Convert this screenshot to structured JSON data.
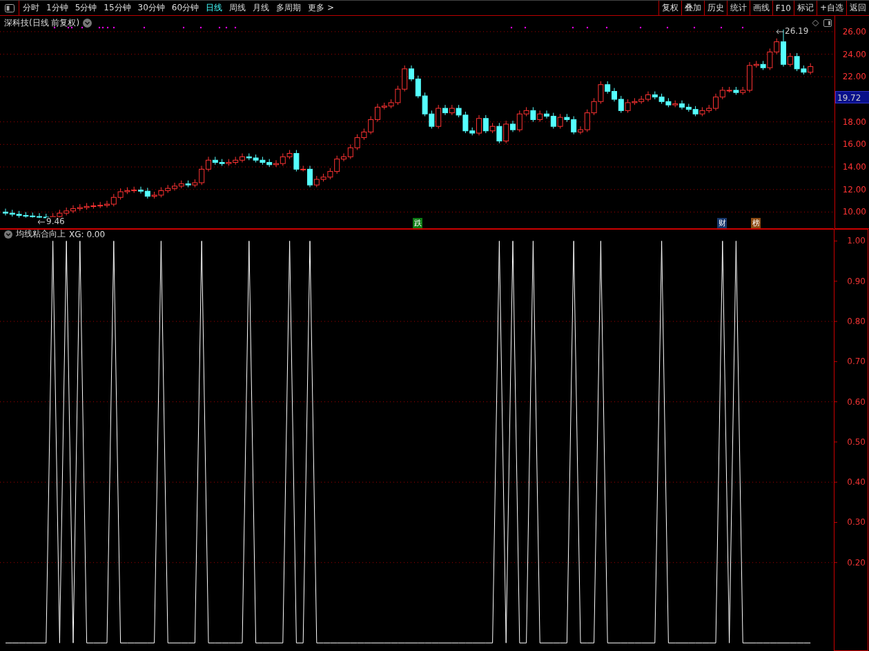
{
  "toolbar": {
    "periods": [
      {
        "label": "分时",
        "selected": false
      },
      {
        "label": "1分钟",
        "selected": false
      },
      {
        "label": "5分钟",
        "selected": false
      },
      {
        "label": "15分钟",
        "selected": false
      },
      {
        "label": "30分钟",
        "selected": false
      },
      {
        "label": "60分钟",
        "selected": false
      },
      {
        "label": "日线",
        "selected": true
      },
      {
        "label": "周线",
        "selected": false
      },
      {
        "label": "月线",
        "selected": false
      },
      {
        "label": "多周期",
        "selected": false
      },
      {
        "label": "更多 >",
        "selected": false
      }
    ],
    "buttons": [
      "复权",
      "叠加",
      "历史",
      "统计",
      "画线",
      "F10",
      "标记",
      "+自选",
      "返回"
    ]
  },
  "price_chart": {
    "title": "深科技(日线 前复权)",
    "current_price": "19.72",
    "high_label": "26.19",
    "low_label": "9.46",
    "markers": [
      {
        "label": "跌",
        "color": "#0b7a12"
      },
      {
        "label": "财",
        "color": "#17376b"
      },
      {
        "label": "榜",
        "color": "#8b4a12"
      }
    ],
    "chart_data": {
      "type": "candlestick",
      "ylim": [
        8.5,
        27.4
      ],
      "grid": true,
      "yticks": [
        {
          "value": 26,
          "label": "26.00"
        },
        {
          "value": 24,
          "label": "24.00"
        },
        {
          "value": 22,
          "label": "22.00"
        },
        {
          "value": 18,
          "label": "18.00"
        },
        {
          "value": 16,
          "label": "16.00"
        },
        {
          "value": 14,
          "label": "14.00"
        },
        {
          "value": 12,
          "label": "12.00"
        },
        {
          "value": 10,
          "label": "10.00"
        }
      ],
      "ohlc": [
        [
          10.0,
          10.3,
          9.7,
          9.9
        ],
        [
          9.9,
          10.2,
          9.6,
          9.8
        ],
        [
          9.8,
          10.1,
          9.5,
          9.7
        ],
        [
          9.7,
          10.0,
          9.5,
          9.65
        ],
        [
          9.65,
          9.95,
          9.5,
          9.6
        ],
        [
          9.6,
          9.9,
          9.46,
          9.55
        ],
        [
          9.55,
          9.85,
          9.5,
          9.5
        ],
        [
          9.5,
          9.9,
          9.5,
          9.6
        ],
        [
          9.6,
          10.2,
          9.4,
          9.9
        ],
        [
          9.9,
          10.4,
          9.7,
          10.1
        ],
        [
          10.1,
          10.6,
          9.9,
          10.3
        ],
        [
          10.3,
          10.7,
          10.1,
          10.4
        ],
        [
          10.4,
          10.8,
          10.2,
          10.5
        ],
        [
          10.5,
          10.85,
          10.3,
          10.55
        ],
        [
          10.55,
          10.9,
          10.35,
          10.6
        ],
        [
          10.6,
          11.0,
          10.4,
          10.7
        ],
        [
          10.7,
          11.6,
          10.5,
          11.3
        ],
        [
          11.3,
          12.1,
          11.1,
          11.8
        ],
        [
          11.8,
          12.2,
          11.6,
          11.9
        ],
        [
          11.9,
          12.25,
          11.7,
          11.95
        ],
        [
          11.95,
          12.25,
          11.65,
          11.85
        ],
        [
          11.85,
          12.15,
          11.2,
          11.4
        ],
        [
          11.4,
          11.8,
          11.2,
          11.5
        ],
        [
          11.5,
          12.2,
          11.3,
          11.9
        ],
        [
          11.9,
          12.4,
          11.7,
          12.1
        ],
        [
          12.1,
          12.6,
          11.9,
          12.3
        ],
        [
          12.3,
          12.8,
          12.1,
          12.5
        ],
        [
          12.5,
          12.8,
          12.2,
          12.4
        ],
        [
          12.4,
          12.9,
          12.2,
          12.6
        ],
        [
          12.6,
          14.1,
          12.4,
          13.8
        ],
        [
          13.8,
          14.9,
          13.6,
          14.6
        ],
        [
          14.6,
          14.9,
          14.2,
          14.4
        ],
        [
          14.4,
          14.7,
          14.1,
          14.3
        ],
        [
          14.3,
          14.7,
          14.1,
          14.4
        ],
        [
          14.4,
          14.9,
          14.2,
          14.6
        ],
        [
          14.6,
          15.2,
          14.4,
          14.9
        ],
        [
          14.9,
          15.2,
          14.6,
          14.8
        ],
        [
          14.8,
          15.1,
          14.4,
          14.6
        ],
        [
          14.6,
          14.9,
          14.2,
          14.4
        ],
        [
          14.4,
          14.7,
          14.0,
          14.2
        ],
        [
          14.2,
          14.6,
          14.0,
          14.3
        ],
        [
          14.3,
          15.2,
          14.1,
          14.9
        ],
        [
          14.9,
          15.5,
          14.7,
          15.2
        ],
        [
          15.2,
          15.5,
          13.6,
          13.8
        ],
        [
          13.8,
          14.1,
          13.6,
          13.8
        ],
        [
          13.8,
          14.1,
          12.2,
          12.4
        ],
        [
          12.4,
          13.2,
          12.2,
          12.9
        ],
        [
          12.9,
          13.4,
          12.7,
          13.1
        ],
        [
          13.1,
          13.9,
          12.9,
          13.6
        ],
        [
          13.6,
          15.0,
          13.4,
          14.7
        ],
        [
          14.7,
          15.2,
          14.5,
          14.9
        ],
        [
          14.9,
          16.0,
          14.7,
          15.7
        ],
        [
          15.7,
          16.9,
          15.5,
          16.6
        ],
        [
          16.6,
          17.4,
          16.4,
          17.1
        ],
        [
          17.1,
          18.5,
          16.9,
          18.2
        ],
        [
          18.2,
          19.6,
          18.0,
          19.3
        ],
        [
          19.3,
          19.7,
          19.1,
          19.4
        ],
        [
          19.4,
          20.0,
          19.2,
          19.7
        ],
        [
          19.7,
          21.2,
          19.5,
          20.9
        ],
        [
          20.9,
          23.0,
          20.7,
          22.7
        ],
        [
          22.7,
          23.0,
          21.6,
          21.8
        ],
        [
          21.8,
          22.1,
          20.1,
          20.3
        ],
        [
          20.3,
          20.6,
          18.5,
          18.7
        ],
        [
          18.7,
          19.0,
          17.4,
          17.6
        ],
        [
          17.6,
          19.5,
          17.4,
          19.2
        ],
        [
          19.2,
          19.5,
          18.6,
          18.8
        ],
        [
          18.8,
          19.5,
          18.6,
          19.2
        ],
        [
          19.2,
          19.5,
          18.4,
          18.6
        ],
        [
          18.6,
          18.9,
          17.0,
          17.2
        ],
        [
          17.2,
          17.5,
          16.8,
          17.0
        ],
        [
          17.0,
          18.6,
          16.8,
          18.3
        ],
        [
          18.3,
          18.6,
          17.0,
          17.2
        ],
        [
          17.2,
          17.9,
          17.0,
          17.6
        ],
        [
          17.6,
          17.9,
          16.1,
          16.3
        ],
        [
          16.3,
          18.1,
          16.1,
          17.8
        ],
        [
          17.8,
          18.1,
          17.1,
          17.3
        ],
        [
          17.3,
          19.0,
          17.1,
          18.7
        ],
        [
          18.7,
          19.3,
          18.5,
          19.0
        ],
        [
          19.0,
          19.3,
          18.0,
          18.2
        ],
        [
          18.2,
          19.0,
          18.0,
          18.7
        ],
        [
          18.7,
          19.0,
          18.3,
          18.5
        ],
        [
          18.5,
          18.8,
          17.4,
          17.6
        ],
        [
          17.6,
          18.7,
          17.4,
          18.4
        ],
        [
          18.4,
          18.7,
          18.0,
          18.2
        ],
        [
          18.2,
          18.5,
          16.9,
          17.1
        ],
        [
          17.1,
          17.6,
          16.9,
          17.3
        ],
        [
          17.3,
          19.1,
          17.1,
          18.8
        ],
        [
          18.8,
          20.1,
          18.6,
          19.8
        ],
        [
          19.8,
          21.6,
          19.6,
          21.3
        ],
        [
          21.3,
          21.6,
          20.5,
          20.7
        ],
        [
          20.7,
          21.0,
          19.8,
          20.0
        ],
        [
          20.0,
          20.3,
          18.8,
          19.0
        ],
        [
          19.0,
          20.0,
          18.8,
          19.7
        ],
        [
          19.7,
          20.1,
          19.5,
          19.8
        ],
        [
          19.8,
          20.3,
          19.6,
          20.0
        ],
        [
          20.0,
          20.7,
          19.8,
          20.4
        ],
        [
          20.4,
          20.7,
          20.0,
          20.2
        ],
        [
          20.2,
          20.5,
          19.6,
          19.8
        ],
        [
          19.8,
          20.1,
          19.3,
          19.5
        ],
        [
          19.5,
          19.9,
          19.3,
          19.6
        ],
        [
          19.6,
          19.9,
          19.1,
          19.3
        ],
        [
          19.3,
          19.6,
          18.9,
          19.1
        ],
        [
          19.1,
          19.4,
          18.5,
          18.7
        ],
        [
          18.7,
          19.3,
          18.5,
          19.0
        ],
        [
          19.0,
          19.5,
          18.8,
          19.2
        ],
        [
          19.2,
          20.5,
          19.0,
          20.2
        ],
        [
          20.2,
          21.1,
          20.0,
          20.8
        ],
        [
          20.8,
          21.1,
          20.6,
          20.8
        ],
        [
          20.8,
          21.1,
          20.4,
          20.6
        ],
        [
          20.6,
          21.1,
          20.4,
          20.8
        ],
        [
          20.8,
          23.3,
          20.6,
          23.0
        ],
        [
          23.0,
          23.4,
          22.8,
          23.1
        ],
        [
          23.1,
          23.4,
          22.6,
          22.8
        ],
        [
          22.8,
          24.5,
          22.6,
          24.2
        ],
        [
          24.2,
          25.4,
          24.0,
          25.1
        ],
        [
          25.1,
          26.19,
          22.9,
          23.1
        ],
        [
          23.1,
          24.1,
          22.9,
          23.8
        ],
        [
          23.8,
          24.1,
          22.5,
          22.7
        ],
        [
          22.7,
          23.0,
          22.2,
          22.4
        ],
        [
          22.4,
          23.2,
          22.2,
          22.9
        ]
      ]
    }
  },
  "indicator": {
    "name": "均线粘合向上",
    "reading": "XG: 0.00",
    "chart_data": {
      "type": "line",
      "ylim": [
        -0.02,
        1.03
      ],
      "grid": true,
      "yticks": [
        {
          "value": 1,
          "label": "1.00"
        },
        {
          "value": 0.9,
          "label": "0.90"
        },
        {
          "value": 0.8,
          "label": "0.80"
        },
        {
          "value": 0.7,
          "label": "0.70"
        },
        {
          "value": 0.6,
          "label": "0.60"
        },
        {
          "value": 0.5,
          "label": "0.50"
        },
        {
          "value": 0.4,
          "label": "0.40"
        },
        {
          "value": 0.3,
          "label": "0.30"
        },
        {
          "value": 0.2,
          "label": "0.20"
        }
      ],
      "values": [
        0,
        0,
        0,
        0,
        0,
        0,
        0,
        1,
        0,
        1,
        0,
        1,
        0,
        0,
        0,
        0,
        1,
        0,
        0,
        0,
        0,
        0,
        0,
        1,
        0,
        0,
        0,
        0,
        0,
        1,
        0,
        0,
        0,
        0,
        0,
        0,
        1,
        0,
        0,
        0,
        0,
        0,
        1,
        0,
        0,
        1,
        0,
        0,
        0,
        0,
        0,
        0,
        0,
        0,
        0,
        0,
        0,
        0,
        0,
        0,
        0,
        0,
        0,
        0,
        0,
        0,
        0,
        0,
        0,
        0,
        0,
        0,
        0,
        1,
        0,
        1,
        0,
        0,
        1,
        0,
        0,
        0,
        0,
        0,
        1,
        0,
        0,
        0,
        1,
        0,
        0,
        0,
        0,
        0,
        0,
        0,
        0,
        1,
        0,
        0,
        0,
        0,
        0,
        0,
        0,
        0,
        1,
        0,
        1,
        0,
        0,
        0,
        0,
        0,
        0,
        0,
        0,
        0,
        0,
        0
      ]
    }
  }
}
